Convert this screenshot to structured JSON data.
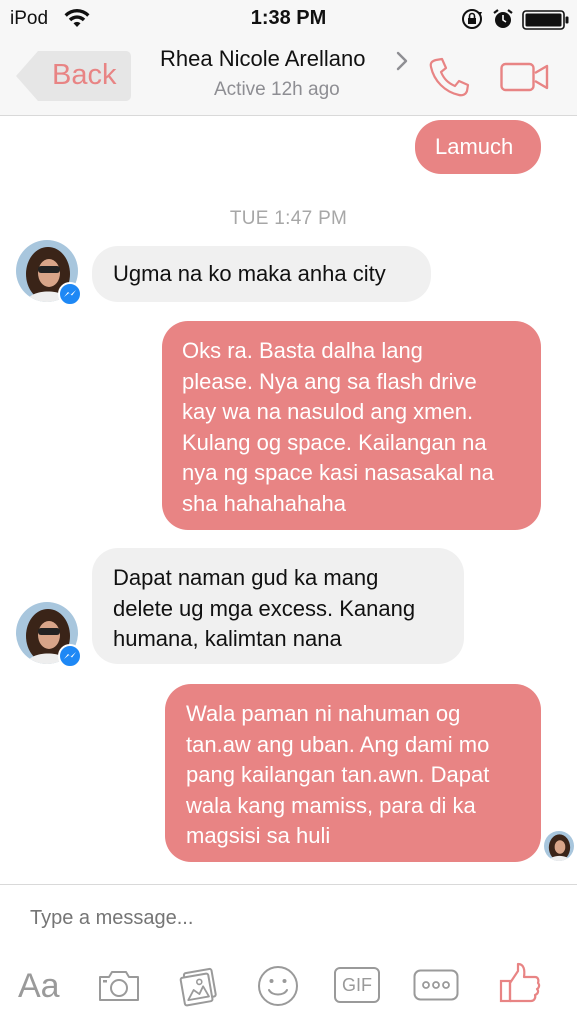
{
  "status_bar": {
    "carrier": "iPod",
    "time": "1:38 PM"
  },
  "header": {
    "back_label": "Back",
    "contact_name": "Rhea Nicole Arellano",
    "active_status": "Active 12h ago"
  },
  "messages": [
    {
      "direction": "sent",
      "text": "Lamuch"
    },
    {
      "direction": "received",
      "text": "Ugma na ko maka anha city"
    },
    {
      "direction": "sent",
      "lines": [
        "Oks ra. Basta dalha lang",
        "please. Nya ang sa flash drive",
        "kay wa na nasulod ang xmen.",
        "Kulang og space. Kailangan na",
        "nya ng space kasi nasasakal na",
        "sha hahahahaha"
      ]
    },
    {
      "direction": "received",
      "lines": [
        "Dapat naman gud ka mang",
        "delete ug mga excess. Kanang",
        "humana, kalimtan nana"
      ]
    },
    {
      "direction": "sent",
      "lines": [
        "Wala paman ni nahuman og",
        "tan.aw ang uban. Ang dami mo",
        "pang kailangan tan.awn. Dapat",
        "wala kang mamiss, para di ka",
        "magsisi sa huli"
      ]
    }
  ],
  "timestamp": "TUE 1:47 PM",
  "composer": {
    "placeholder": "Type a message...",
    "aa_label": "Aa",
    "gif_label": "GIF"
  },
  "colors": {
    "accent": "#e88484",
    "received_bubble": "#f0f0f0",
    "messenger_badge": "#1e88f5"
  },
  "icons": [
    "wifi-icon",
    "lock-rotation-icon",
    "alarm-icon",
    "battery-icon",
    "chevron-right-icon",
    "phone-icon",
    "video-icon",
    "camera-icon",
    "gallery-icon",
    "emoji-icon",
    "gif-icon",
    "more-icon",
    "like-icon"
  ]
}
